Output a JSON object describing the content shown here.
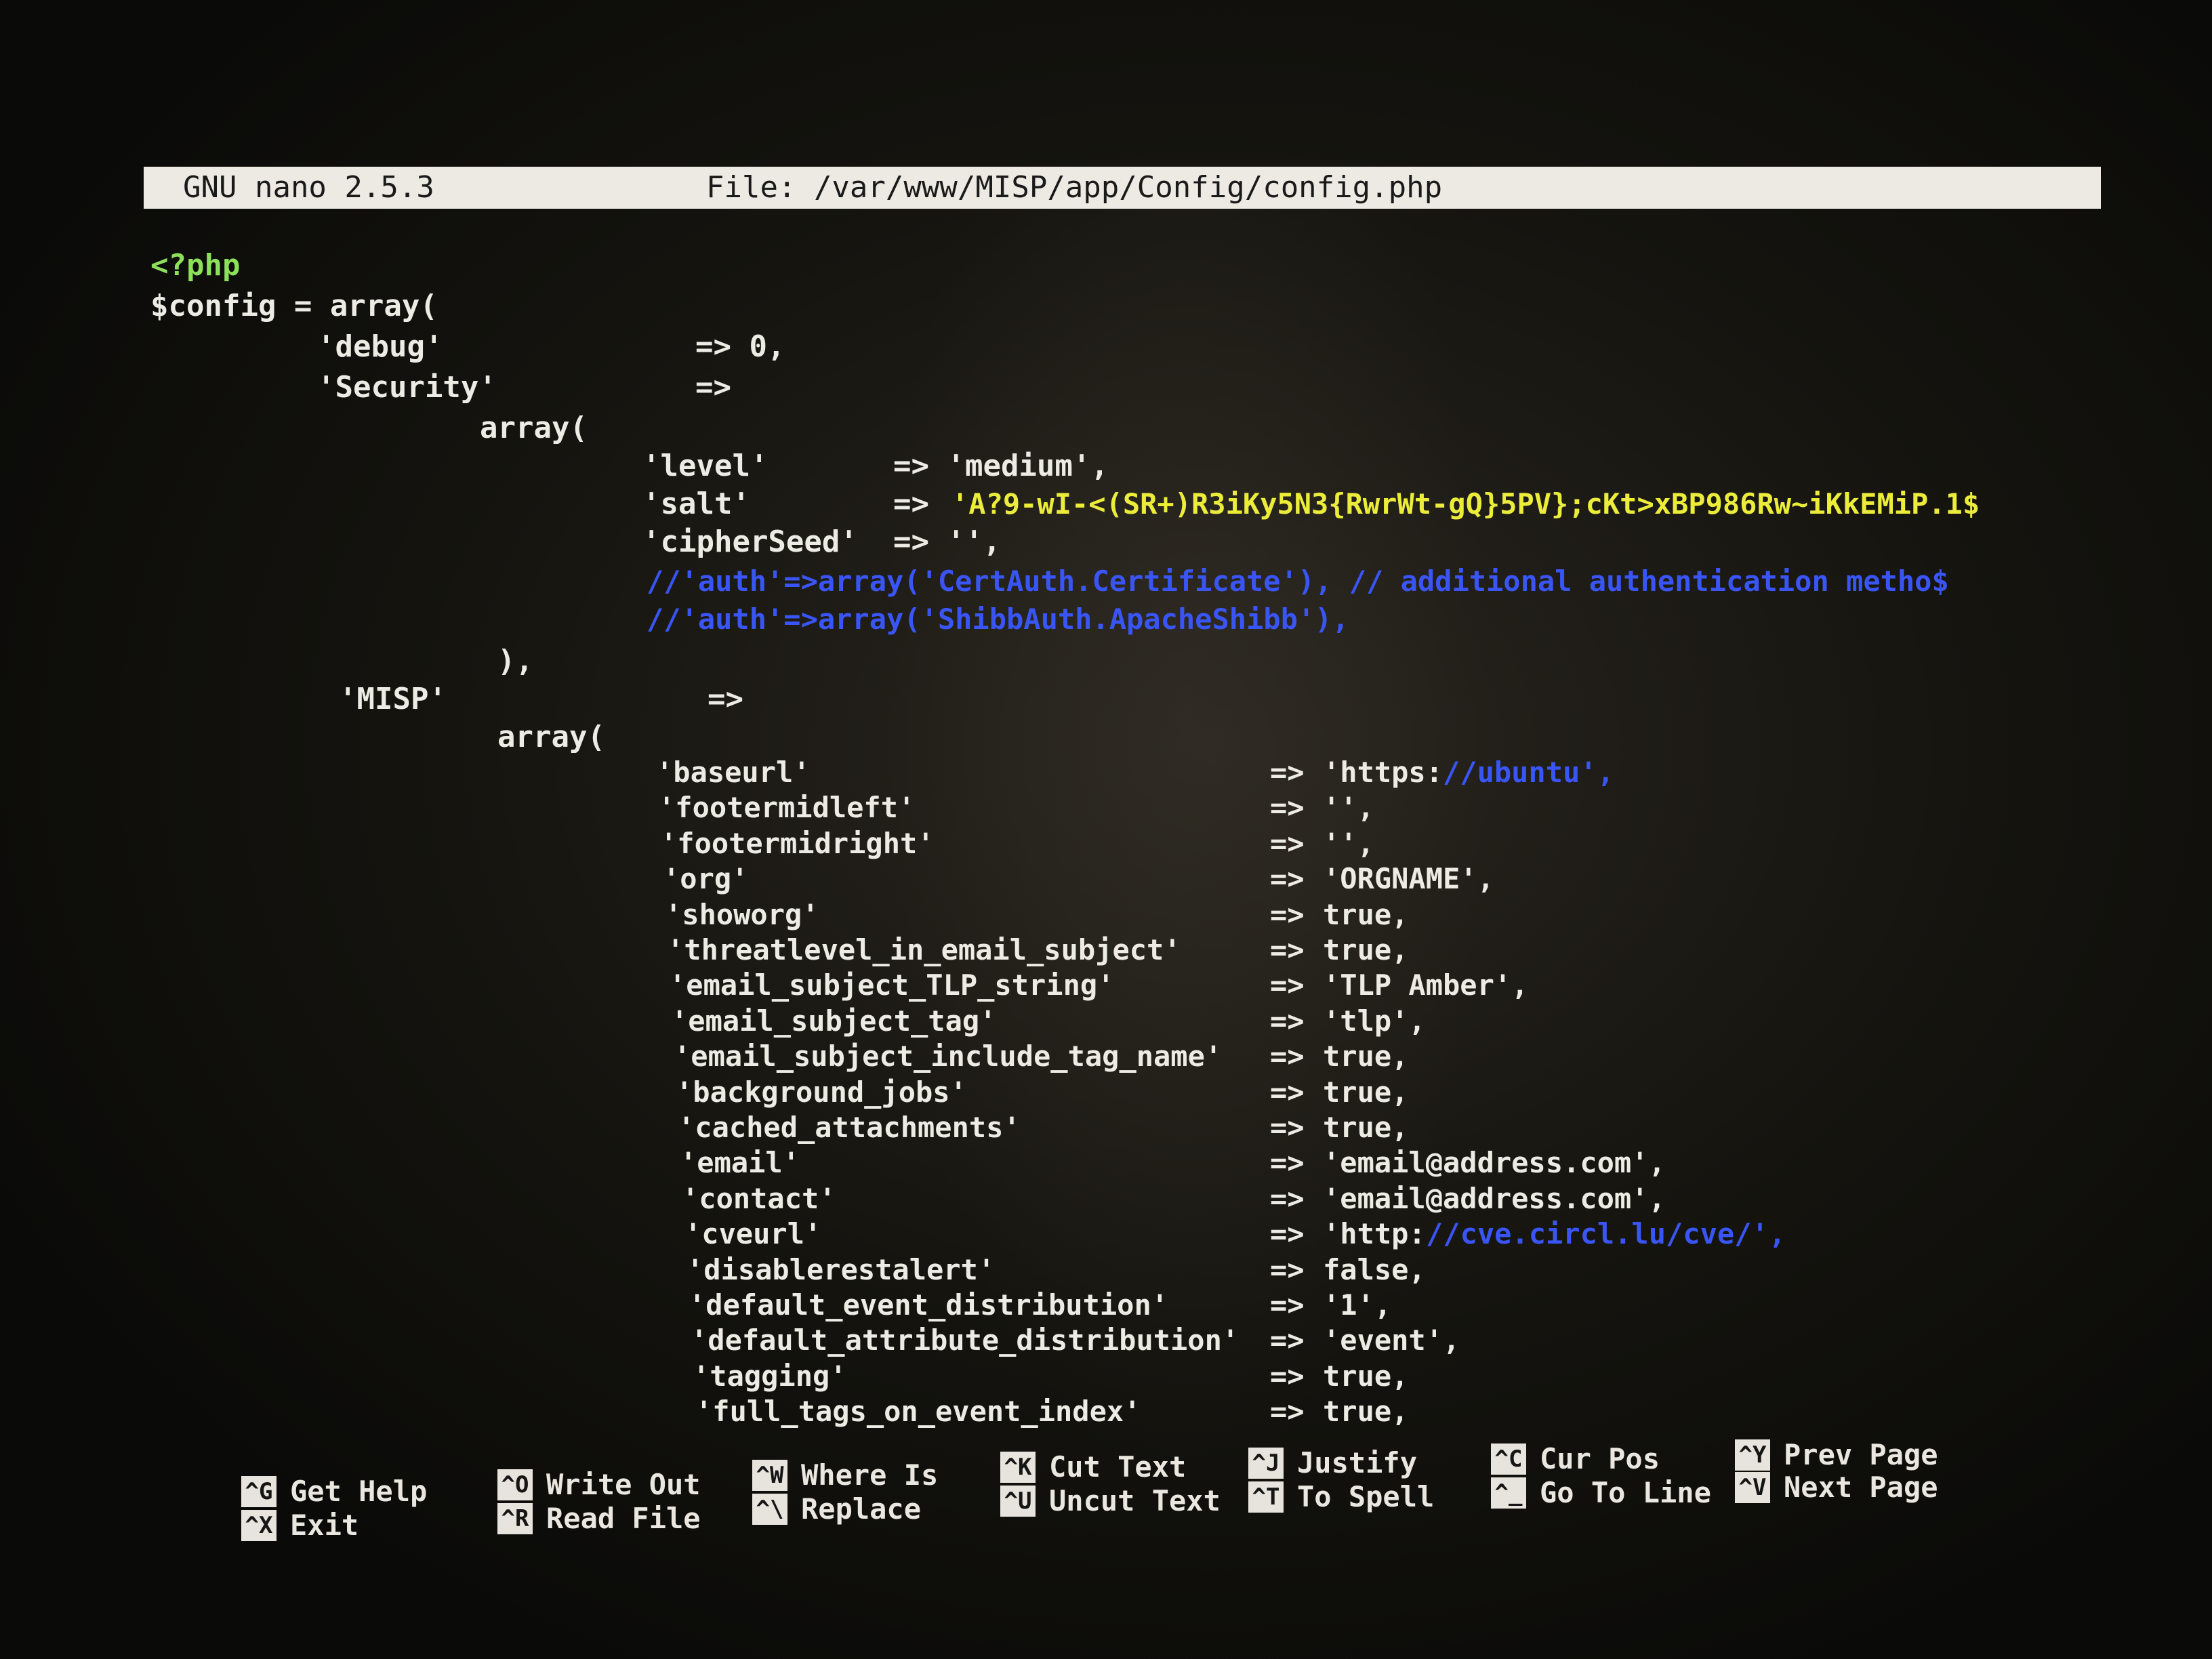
{
  "title_bar": {
    "app": "GNU nano 2.5.3",
    "file_label": "File: /var/www/MISP/app/Config/config.php"
  },
  "code": {
    "l01": "<?php",
    "l02": "$config = array(",
    "l03_key": "'debug'",
    "l03_val": "=> 0,",
    "l04_key": "'Security'",
    "l04_val": "=>",
    "l05": "array(",
    "l06_key": "'level'",
    "l06_val": "=> 'medium',",
    "l07_key": "'salt'",
    "l07_arrow": "=> ",
    "l07_val": "'A?9-wI-<(SR+)R3iKy5N3{RwrWt-gQ}5PV};cKt>xBP986Rw~iKkEMiP.1$",
    "l08_key": "'cipherSeed'",
    "l08_val": "=> '',",
    "l09": "//'auth'=>array('CertAuth.Certificate'), // additional authentication metho$",
    "l10": "//'auth'=>array('ShibbAuth.ApacheShibb'),",
    "l11": "),",
    "l12_key": "'MISP'",
    "l12_val": "=>",
    "l13": "array(",
    "misp_rows": [
      {
        "key": "'baseurl'",
        "arrow": "=> ",
        "val_a": "'https:",
        "val_b": "//ubuntu',"
      },
      {
        "key": "'footermidleft'",
        "arrow": "=> ",
        "val_a": "'',",
        "val_b": ""
      },
      {
        "key": "'footermidright'",
        "arrow": "=> ",
        "val_a": "'',",
        "val_b": ""
      },
      {
        "key": "'org'",
        "arrow": "=> ",
        "val_a": "'ORGNAME',",
        "val_b": ""
      },
      {
        "key": "'showorg'",
        "arrow": "=> ",
        "val_a": "true,",
        "val_b": ""
      },
      {
        "key": "'threatlevel_in_email_subject'",
        "arrow": "=> ",
        "val_a": "true,",
        "val_b": ""
      },
      {
        "key": "'email_subject_TLP_string'",
        "arrow": "=> ",
        "val_a": "'TLP Amber',",
        "val_b": ""
      },
      {
        "key": "'email_subject_tag'",
        "arrow": "=> ",
        "val_a": "'tlp',",
        "val_b": ""
      },
      {
        "key": "'email_subject_include_tag_name'",
        "arrow": "=> ",
        "val_a": "true,",
        "val_b": ""
      },
      {
        "key": "'background_jobs'",
        "arrow": "=> ",
        "val_a": "true,",
        "val_b": ""
      },
      {
        "key": "'cached_attachments'",
        "arrow": "=> ",
        "val_a": "true,",
        "val_b": ""
      },
      {
        "key": "'email'",
        "arrow": "=> ",
        "val_a": "'email@address.com',",
        "val_b": ""
      },
      {
        "key": "'contact'",
        "arrow": "=> ",
        "val_a": "'email@address.com',",
        "val_b": ""
      },
      {
        "key": "'cveurl'",
        "arrow": "=> ",
        "val_a": "'http:",
        "val_b": "//cve.circl.lu/cve/',"
      },
      {
        "key": "'disablerestalert'",
        "arrow": "=> ",
        "val_a": "false,",
        "val_b": ""
      },
      {
        "key": "'default_event_distribution'",
        "arrow": "=> ",
        "val_a": "'1',",
        "val_b": ""
      },
      {
        "key": "'default_attribute_distribution'",
        "arrow": "=> ",
        "val_a": "'event',",
        "val_b": ""
      },
      {
        "key": "'tagging'",
        "arrow": "=> ",
        "val_a": "true,",
        "val_b": ""
      },
      {
        "key": "'full_tags_on_event_index'",
        "arrow": "=> ",
        "val_a": "true,",
        "val_b": ""
      }
    ]
  },
  "shortcuts": [
    {
      "key": "^G",
      "label": "Get Help"
    },
    {
      "key": "^X",
      "label": "Exit"
    },
    {
      "key": "^O",
      "label": "Write Out"
    },
    {
      "key": "^R",
      "label": "Read File"
    },
    {
      "key": "^W",
      "label": "Where Is"
    },
    {
      "key": "^\\",
      "label": "Replace"
    },
    {
      "key": "^K",
      "label": "Cut Text"
    },
    {
      "key": "^U",
      "label": "Uncut Text"
    },
    {
      "key": "^J",
      "label": "Justify"
    },
    {
      "key": "^T",
      "label": "To Spell"
    },
    {
      "key": "^C",
      "label": "Cur Pos"
    },
    {
      "key": "^_",
      "label": "Go To Line"
    },
    {
      "key": "^Y",
      "label": "Prev Page"
    },
    {
      "key": "^V",
      "label": "Next Page"
    }
  ]
}
